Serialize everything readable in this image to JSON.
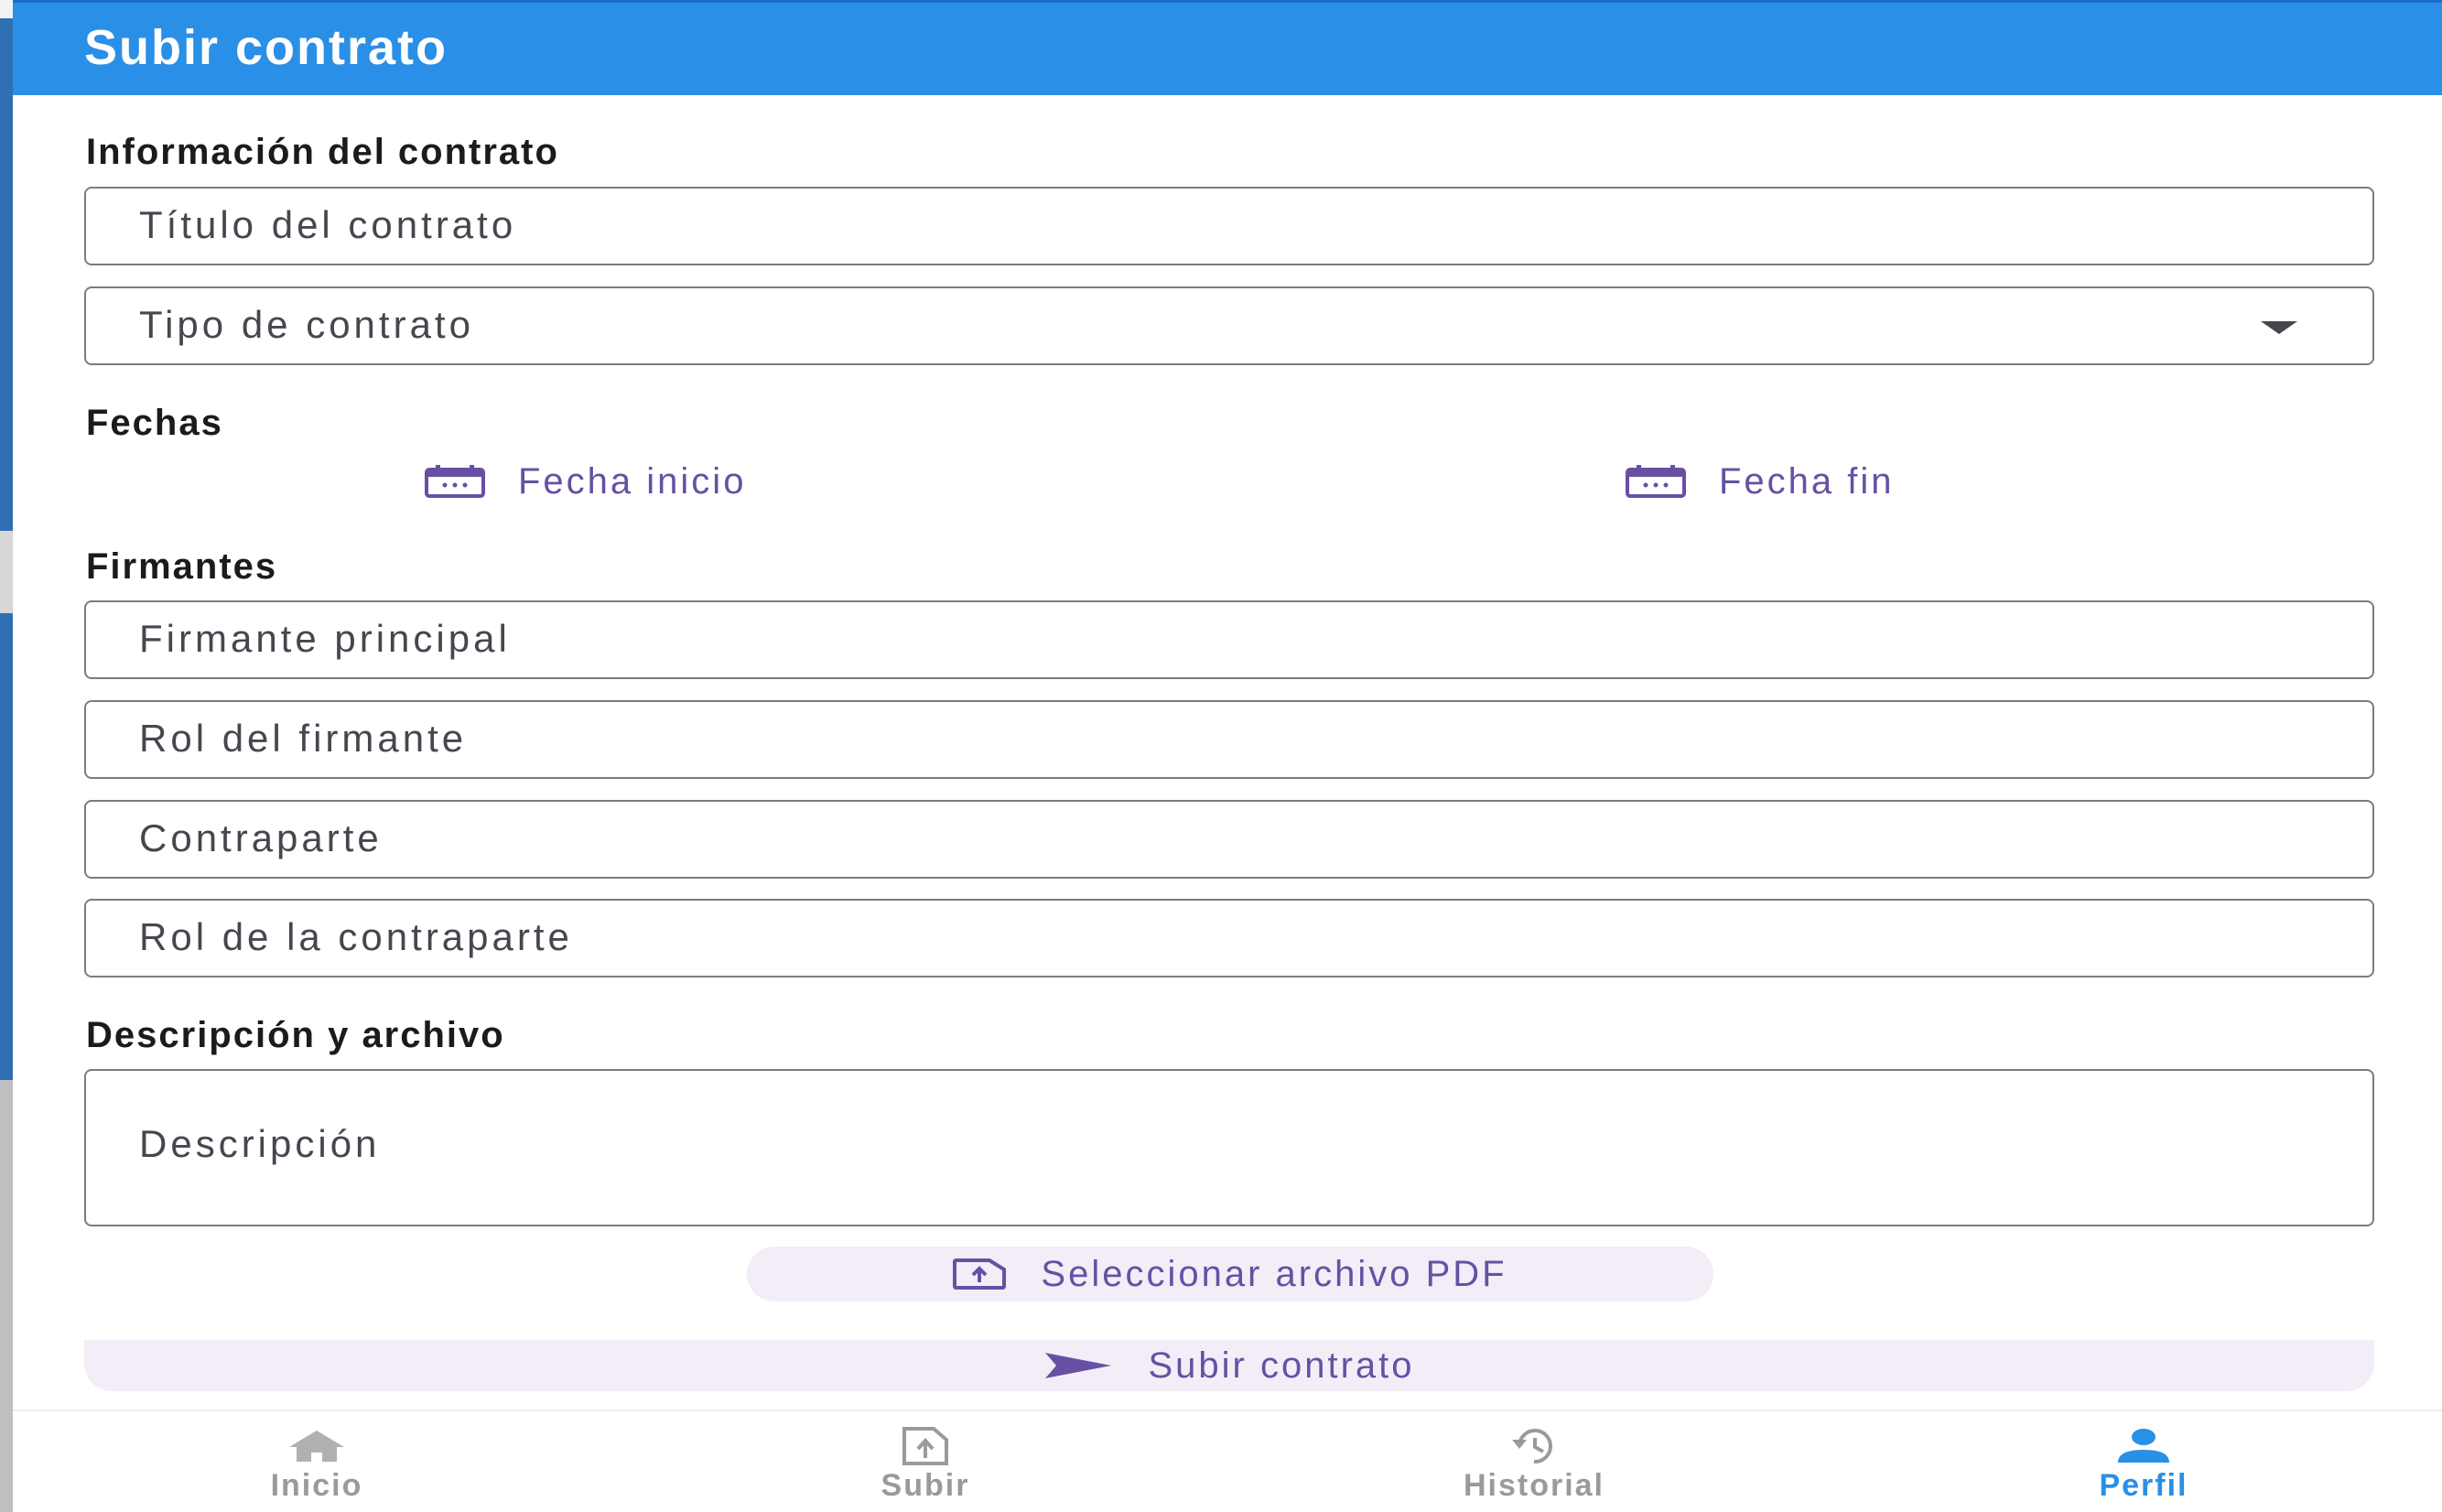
{
  "appbar": {
    "title": "Subir contrato"
  },
  "sections": {
    "info": "Información del contrato",
    "dates": "Fechas",
    "signers": "Firmantes",
    "description": "Descripción y archivo"
  },
  "fields": {
    "title_placeholder": "Título del contrato",
    "type_placeholder": "Tipo de contrato",
    "signer_placeholder": "Firmante principal",
    "signer_role_placeholder": "Rol del firmante",
    "counterparty_placeholder": "Contraparte",
    "counterparty_role_placeholder": "Rol de la contraparte",
    "description_placeholder": "Descripción"
  },
  "dates": {
    "start_label": "Fecha inicio",
    "end_label": "Fecha fin"
  },
  "actions": {
    "select_pdf": "Seleccionar archivo PDF",
    "submit": "Subir contrato"
  },
  "nav": {
    "items": [
      {
        "label": "Inicio",
        "icon": "home-icon",
        "active": false
      },
      {
        "label": "Subir",
        "icon": "upload-file-icon",
        "active": false
      },
      {
        "label": "Historial",
        "icon": "history-icon",
        "active": false
      },
      {
        "label": "Perfil",
        "icon": "person-icon",
        "active": true
      }
    ]
  },
  "colors": {
    "primary": "#2a8fe6",
    "accent": "#6750a4",
    "pill_bg": "#f3edf7"
  }
}
